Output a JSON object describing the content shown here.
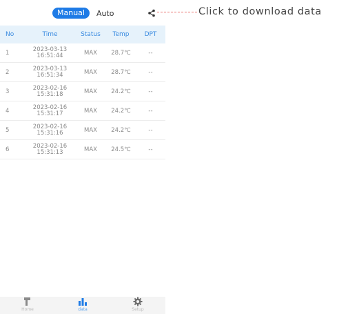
{
  "toggle": {
    "active": "Manual",
    "inactive": "Auto"
  },
  "annotation": "Click to download data",
  "table": {
    "columns": [
      "No",
      "Time",
      "Status",
      "Temp",
      "DPT"
    ],
    "rows": [
      {
        "no": "1",
        "date": "2023-03-13",
        "time": "16:51:44",
        "status": "MAX",
        "temp": "28.7℃",
        "dpt": "--"
      },
      {
        "no": "2",
        "date": "2023-03-13",
        "time": "16:51:34",
        "status": "MAX",
        "temp": "28.7℃",
        "dpt": "--"
      },
      {
        "no": "3",
        "date": "2023-02-16",
        "time": "15:31:18",
        "status": "MAX",
        "temp": "24.2℃",
        "dpt": "--"
      },
      {
        "no": "4",
        "date": "2023-02-16",
        "time": "15:31:17",
        "status": "MAX",
        "temp": "24.2℃",
        "dpt": "--"
      },
      {
        "no": "5",
        "date": "2023-02-16",
        "time": "15:31:16",
        "status": "MAX",
        "temp": "24.2℃",
        "dpt": "--"
      },
      {
        "no": "6",
        "date": "2023-02-16",
        "time": "15:31:13",
        "status": "MAX",
        "temp": "24.5℃",
        "dpt": "--"
      }
    ]
  },
  "nav": [
    {
      "label": "Home",
      "icon": "thermometer-gun-icon",
      "active": false
    },
    {
      "label": "data",
      "icon": "bar-chart-icon",
      "active": true
    },
    {
      "label": "Setup",
      "icon": "gear-icon",
      "active": false
    }
  ],
  "colors": {
    "accent": "#1e7be6",
    "header_bg": "#e6f2fb",
    "annotation_line": "#e8716e"
  }
}
